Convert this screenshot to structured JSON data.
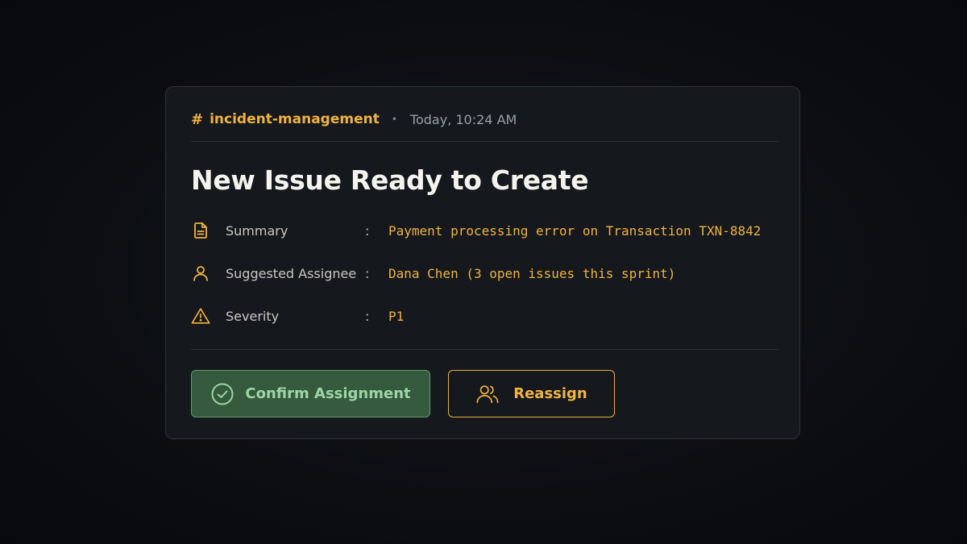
{
  "header": {
    "hash": "#",
    "channel": "incident-management",
    "separator": "•",
    "timestamp": "Today, 10:24 AM"
  },
  "title": "New Issue Ready to Create",
  "fields": [
    {
      "icon": "document-icon",
      "label": "Summary",
      "colon": ":",
      "value": "Payment processing error on Transaction TXN-8842"
    },
    {
      "icon": "user-icon",
      "label": "Suggested Assignee",
      "colon": ":",
      "value": "Dana Chen (3 open issues this sprint)"
    },
    {
      "icon": "warning-icon",
      "label": "Severity",
      "colon": ":",
      "value": "P1"
    }
  ],
  "actions": {
    "confirm": {
      "label": "Confirm Assignment",
      "icon": "check-circle-icon"
    },
    "reassign": {
      "label": "Reassign",
      "icon": "users-icon"
    }
  },
  "colors": {
    "accent": "#f0b341",
    "confirm_bg": "#355a3e",
    "confirm_text": "#9ed5a6",
    "card_bg": "#15181d"
  }
}
